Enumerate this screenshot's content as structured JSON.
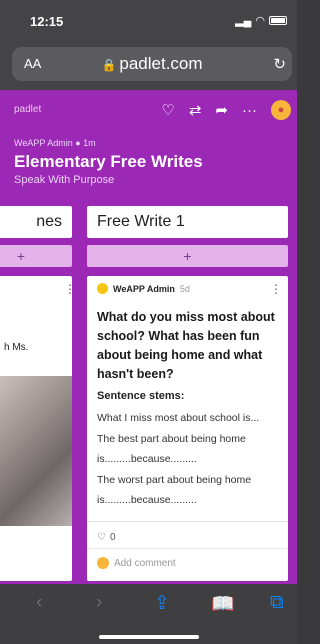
{
  "status": {
    "time": "12:15"
  },
  "browser": {
    "text_size": "AA",
    "url": "padlet.com"
  },
  "padlet": {
    "logo": "padlet",
    "author": "WeAPP Admin",
    "posted": "1m",
    "title": "Elementary Free Writes",
    "subtitle": "Speak With Purpose"
  },
  "columns": [
    {
      "title": "nes",
      "add": "+",
      "card_text": "h Ms."
    },
    {
      "title": "Free Write 1",
      "add": "+",
      "post": {
        "author": "WeAPP Admin",
        "time": "5d",
        "question": "What do you miss most about school? What has been fun about being home and what hasn't been?",
        "stems_heading": "Sentence stems:",
        "stems": [
          "What I miss most about school is...",
          "The best part about being home",
          "is.........because.........",
          "The worst part about being home",
          "is.........because........."
        ],
        "likes": "0",
        "add_comment": "Add comment"
      }
    }
  ],
  "icons": {
    "heart": "heart-icon",
    "remake": "remake-icon",
    "share": "share-icon",
    "more": "more-icon",
    "lock": "lock-icon",
    "reload": "reload-icon"
  },
  "colors": {
    "padlet_purple": "#9c29b5",
    "safari_blue": "#0a84ff"
  }
}
